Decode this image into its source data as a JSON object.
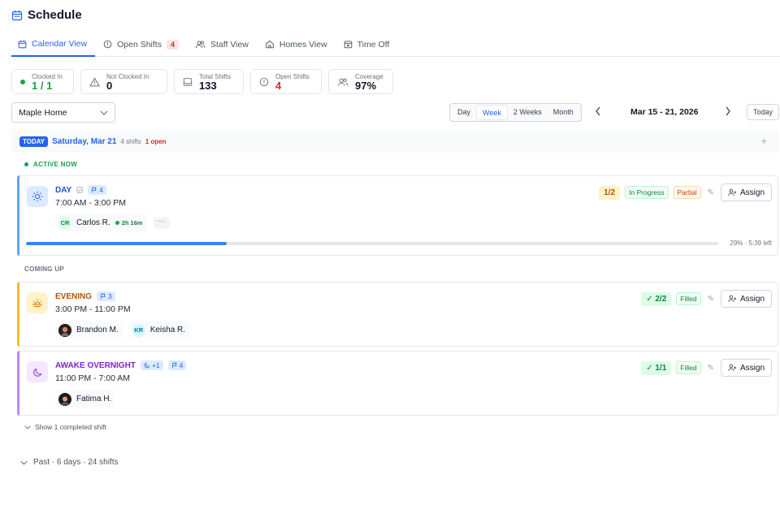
{
  "header": {
    "title": "Schedule",
    "icon": "calendar-icon"
  },
  "tabs": [
    {
      "label": "Calendar View",
      "icon": "calendar-icon",
      "active": true
    },
    {
      "label": "Open Shifts",
      "icon": "alert-circle-icon",
      "badge": "4"
    },
    {
      "label": "Staff View",
      "icon": "users-icon"
    },
    {
      "label": "Homes View",
      "icon": "home-icon"
    },
    {
      "label": "Time Off",
      "icon": "calendar-x-icon"
    }
  ],
  "stats": [
    {
      "label": "Clocked In",
      "value": "1 / 1",
      "icon": "status-dot"
    },
    {
      "label": "Not Clocked In",
      "value": "0",
      "icon": "warning-icon"
    },
    {
      "label": "Total Shifts",
      "value": "133",
      "icon": "inbox-icon"
    },
    {
      "label": "Open Shifts",
      "value": "4",
      "icon": "alert-circle-icon"
    },
    {
      "label": "Coverage",
      "value": "97%",
      "icon": "users-icon"
    }
  ],
  "controls": {
    "home_select": "Maple Home",
    "views": [
      "Day",
      "Week",
      "2 Weeks",
      "Month"
    ],
    "active_view": "Week",
    "date_range": "Mar 15 - 21, 2026",
    "today_label": "Today"
  },
  "day": {
    "today_pill": "TODAY",
    "name": "Saturday, Mar 21",
    "shifts": "4 shifts",
    "open": "1 open"
  },
  "sections": {
    "active_now": "ACTIVE NOW",
    "coming_up": "COMING UP"
  },
  "shifts": [
    {
      "name": "DAY",
      "flag": "4",
      "time": "7:00 AM - 3:00 PM",
      "count": "1/2",
      "status": "In Progress",
      "fill": "Partial",
      "assign": "Assign",
      "staff": [
        {
          "initials": "CR",
          "name": "Carlos R.",
          "clock": "2h 16m"
        }
      ],
      "more": "···",
      "progress_pct": 29,
      "progress_text": "29% · 5:39 left",
      "color": "#60a5fa"
    },
    {
      "name": "EVENING",
      "flag": "3",
      "time": "3:00 PM - 11:00 PM",
      "count": "2/2",
      "fill": "Filled",
      "assign": "Assign",
      "staff": [
        {
          "name": "Brandon M."
        },
        {
          "initials": "KR",
          "name": "Keisha R."
        }
      ],
      "color": "#fbbf24"
    },
    {
      "name": "AWAKE OVERNIGHT",
      "tag": "+1",
      "flag": "4",
      "time": "11:00 PM - 7:00 AM",
      "count": "1/1",
      "fill": "Filled",
      "assign": "Assign",
      "staff": [
        {
          "name": "Fatima H."
        }
      ],
      "color": "#c084fc"
    }
  ],
  "footer": {
    "show_completed": "Show 1 completed shift",
    "past": "Past · 6 days · 24 shifts"
  }
}
